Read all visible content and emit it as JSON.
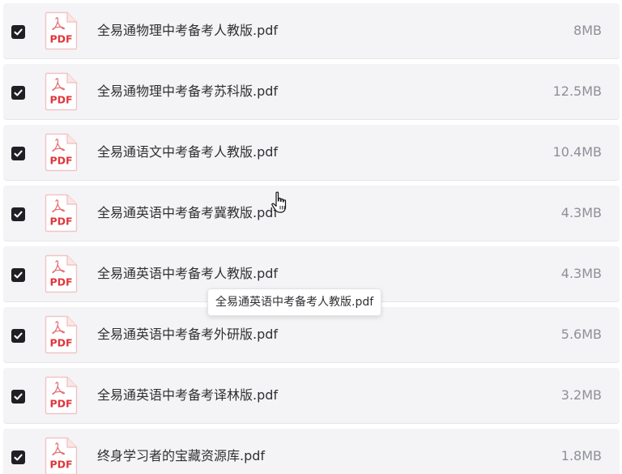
{
  "colors": {
    "row_bg": "#f4f4f6",
    "checkbox": "#1f1f24",
    "pdf_red": "#e0373b",
    "size_text": "#8e9097"
  },
  "files": [
    {
      "name": "全易通物理中考备考人教版.pdf",
      "size": "8MB",
      "checked": true,
      "icon": "pdf-file-icon",
      "icon_label": "PDF"
    },
    {
      "name": "全易通物理中考备考苏科版.pdf",
      "size": "12.5MB",
      "checked": true,
      "icon": "pdf-file-icon",
      "icon_label": "PDF"
    },
    {
      "name": "全易通语文中考备考人教版.pdf",
      "size": "10.4MB",
      "checked": true,
      "icon": "pdf-file-icon",
      "icon_label": "PDF"
    },
    {
      "name": "全易通英语中考备考冀教版.pdf",
      "size": "4.3MB",
      "checked": true,
      "icon": "pdf-file-icon",
      "icon_label": "PDF"
    },
    {
      "name": "全易通英语中考备考人教版.pdf",
      "size": "4.3MB",
      "checked": true,
      "icon": "pdf-file-icon",
      "icon_label": "PDF"
    },
    {
      "name": "全易通英语中考备考外研版.pdf",
      "size": "5.6MB",
      "checked": true,
      "icon": "pdf-file-icon",
      "icon_label": "PDF"
    },
    {
      "name": "全易通英语中考备考译林版.pdf",
      "size": "3.2MB",
      "checked": true,
      "icon": "pdf-file-icon",
      "icon_label": "PDF"
    },
    {
      "name": "终身学习者的宝藏资源库.pdf",
      "size": "1.8MB",
      "checked": true,
      "icon": "pdf-file-icon",
      "icon_label": "PDF"
    }
  ],
  "tooltip": {
    "text": "全易通英语中考备考人教版.pdf"
  },
  "cursor": {
    "icon": "hand-pointer-icon"
  }
}
